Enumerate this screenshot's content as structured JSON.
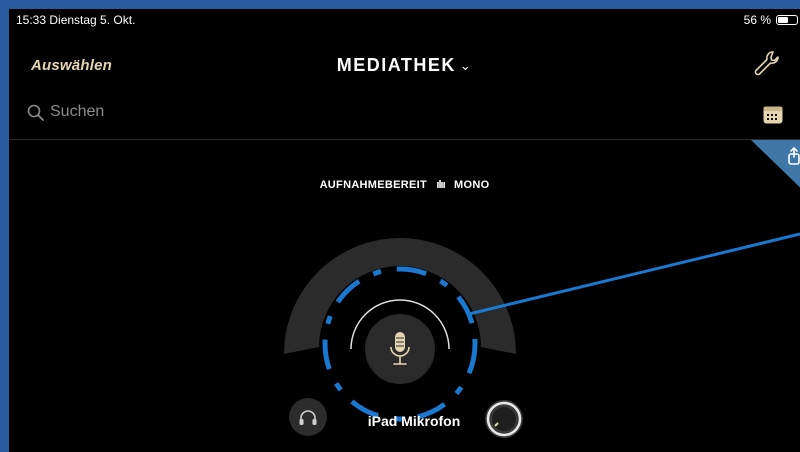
{
  "status_bar": {
    "time_date": "15:33  Dienstag 5. Okt.",
    "battery_percent_text": "56 %",
    "battery_level": 0.56
  },
  "nav": {
    "left_label": "Auswählen",
    "title": "MEDIATHEK",
    "title_chevron": "chevron-down-icon",
    "right_icon": "wrench-icon"
  },
  "search": {
    "placeholder": "Suchen",
    "icon": "search-icon"
  },
  "calendar_icon": "calendar-icon",
  "corner_icon": "share-icon",
  "recorder": {
    "status_left": "AUFNAHMEBEREIT",
    "status_icon": "waveform-icon",
    "status_right": "MONO",
    "input_label": "iPad Mikrofon",
    "mic_icon": "microphone-icon",
    "headphone_icon": "headphones-icon",
    "knob_icon": "gain-knob-icon"
  },
  "colors": {
    "frame": "#2a5aa0",
    "accent_gold": "#e6d6b0",
    "annotation_blue": "#1a78d0",
    "corner_blue": "#3f78a8"
  }
}
